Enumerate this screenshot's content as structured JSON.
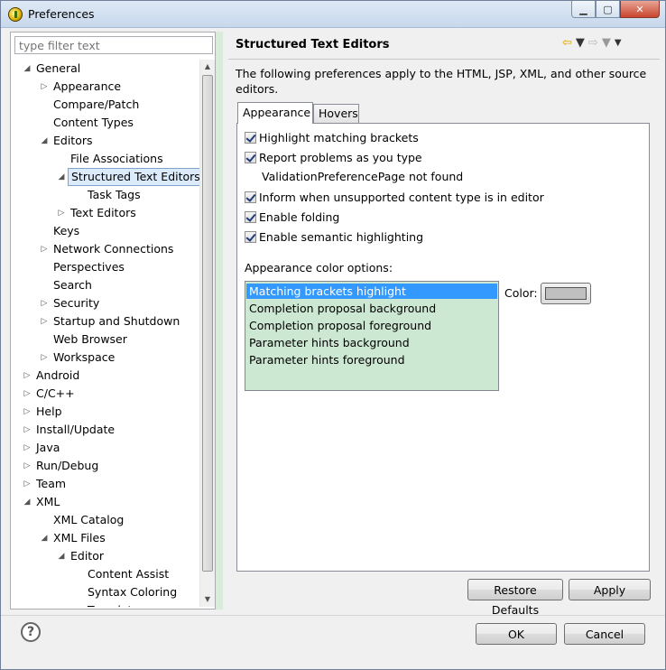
{
  "window": {
    "title": "Preferences"
  },
  "filter": {
    "placeholder": "type filter text"
  },
  "tree": [
    {
      "label": "General",
      "indent": 0,
      "toggle": "open"
    },
    {
      "label": "Appearance",
      "indent": 1,
      "toggle": "closed"
    },
    {
      "label": "Compare/Patch",
      "indent": 1,
      "toggle": ""
    },
    {
      "label": "Content Types",
      "indent": 1,
      "toggle": ""
    },
    {
      "label": "Editors",
      "indent": 1,
      "toggle": "open"
    },
    {
      "label": "File Associations",
      "indent": 2,
      "toggle": ""
    },
    {
      "label": "Structured Text Editors",
      "indent": 2,
      "toggle": "open",
      "selected": true
    },
    {
      "label": "Task Tags",
      "indent": 3,
      "toggle": ""
    },
    {
      "label": "Text Editors",
      "indent": 2,
      "toggle": "closed"
    },
    {
      "label": "Keys",
      "indent": 1,
      "toggle": ""
    },
    {
      "label": "Network Connections",
      "indent": 1,
      "toggle": "closed"
    },
    {
      "label": "Perspectives",
      "indent": 1,
      "toggle": ""
    },
    {
      "label": "Search",
      "indent": 1,
      "toggle": ""
    },
    {
      "label": "Security",
      "indent": 1,
      "toggle": "closed"
    },
    {
      "label": "Startup and Shutdown",
      "indent": 1,
      "toggle": "closed"
    },
    {
      "label": "Web Browser",
      "indent": 1,
      "toggle": ""
    },
    {
      "label": "Workspace",
      "indent": 1,
      "toggle": "closed"
    },
    {
      "label": "Android",
      "indent": 0,
      "toggle": "closed"
    },
    {
      "label": "C/C++",
      "indent": 0,
      "toggle": "closed"
    },
    {
      "label": "Help",
      "indent": 0,
      "toggle": "closed"
    },
    {
      "label": "Install/Update",
      "indent": 0,
      "toggle": "closed"
    },
    {
      "label": "Java",
      "indent": 0,
      "toggle": "closed"
    },
    {
      "label": "Run/Debug",
      "indent": 0,
      "toggle": "closed"
    },
    {
      "label": "Team",
      "indent": 0,
      "toggle": "closed"
    },
    {
      "label": "XML",
      "indent": 0,
      "toggle": "open"
    },
    {
      "label": "XML Catalog",
      "indent": 1,
      "toggle": ""
    },
    {
      "label": "XML Files",
      "indent": 1,
      "toggle": "open"
    },
    {
      "label": "Editor",
      "indent": 2,
      "toggle": "open"
    },
    {
      "label": "Content Assist",
      "indent": 3,
      "toggle": ""
    },
    {
      "label": "Syntax Coloring",
      "indent": 3,
      "toggle": ""
    },
    {
      "label": "Templates",
      "indent": 3,
      "toggle": ""
    }
  ],
  "page": {
    "title": "Structured Text Editors",
    "description": "The following preferences apply to the HTML, JSP, XML, and other source editors."
  },
  "tabs": {
    "appearance": "Appearance",
    "hovers": "Hovers"
  },
  "options": {
    "highlight_brackets": "Highlight matching brackets",
    "report_problems": "Report problems as you type",
    "validation_note": "ValidationPreferencePage not found",
    "inform_unsupported": "Inform when unsupported content type is in editor",
    "enable_folding": "Enable folding",
    "enable_semantic": "Enable semantic highlighting"
  },
  "color_options": {
    "label": "Appearance color options:",
    "items": [
      "Matching brackets highlight",
      "Completion proposal background",
      "Completion proposal foreground",
      "Parameter hints background",
      "Parameter hints foreground"
    ],
    "color_label": "Color:",
    "swatch": "#c0c0c0"
  },
  "buttons": {
    "restore_defaults": "Restore Defaults",
    "apply": "Apply",
    "ok": "OK",
    "cancel": "Cancel"
  },
  "icons": {
    "help": "?",
    "minimize": "▁",
    "maximize": "▢",
    "close": "✕",
    "back": "⇦",
    "forward": "⇨",
    "dropdown": "▼"
  }
}
